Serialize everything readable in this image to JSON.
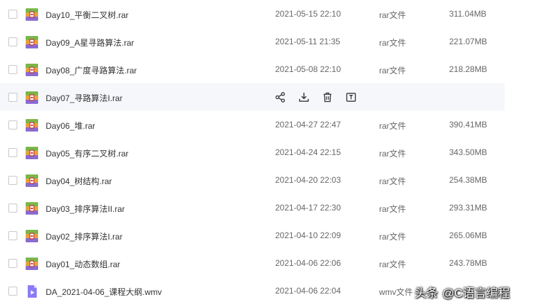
{
  "files": [
    {
      "name": "Day10_平衡二叉树.rar",
      "date": "2021-05-15 22:10",
      "type": "rar文件",
      "size": "311.04MB",
      "icon": "rar-archive-icon"
    },
    {
      "name": "Day09_A星寻路算法.rar",
      "date": "2021-05-11 21:35",
      "type": "rar文件",
      "size": "221.07MB",
      "icon": "rar-archive-icon"
    },
    {
      "name": "Day08_广度寻路算法.rar",
      "date": "2021-05-08 22:10",
      "type": "rar文件",
      "size": "218.28MB",
      "icon": "rar-archive-icon"
    },
    {
      "name": "Day07_寻路算法I.rar",
      "date": "",
      "type": "",
      "size": "",
      "icon": "rar-archive-icon",
      "hovered": true
    },
    {
      "name": "Day06_堆.rar",
      "date": "2021-04-27 22:47",
      "type": "rar文件",
      "size": "390.41MB",
      "icon": "rar-archive-icon"
    },
    {
      "name": "Day05_有序二叉树.rar",
      "date": "2021-04-24 22:15",
      "type": "rar文件",
      "size": "343.50MB",
      "icon": "rar-archive-icon"
    },
    {
      "name": "Day04_树结构.rar",
      "date": "2021-04-20 22:03",
      "type": "rar文件",
      "size": "254.38MB",
      "icon": "rar-archive-icon"
    },
    {
      "name": "Day03_排序算法II.rar",
      "date": "2021-04-17 22:30",
      "type": "rar文件",
      "size": "293.31MB",
      "icon": "rar-archive-icon"
    },
    {
      "name": "Day02_排序算法I.rar",
      "date": "2021-04-10 22:09",
      "type": "rar文件",
      "size": "265.06MB",
      "icon": "rar-archive-icon"
    },
    {
      "name": "Day01_动态数组.rar",
      "date": "2021-04-06 22:06",
      "type": "rar文件",
      "size": "243.78MB",
      "icon": "rar-archive-icon"
    },
    {
      "name": "DA_2021-04-06_课程大纲.wmv",
      "date": "2021-04-06 22:04",
      "type": "wmv文件",
      "size": "",
      "icon": "video-file-icon"
    }
  ],
  "hover_actions": [
    "share-icon",
    "download-icon",
    "delete-icon",
    "rename-icon"
  ],
  "watermark": {
    "source": "头条",
    "account": "@C语言编程"
  },
  "colors": {
    "hover_bg": "#f5f7fa",
    "text": "#333333",
    "muted": "#666666",
    "icon": "#333333"
  }
}
